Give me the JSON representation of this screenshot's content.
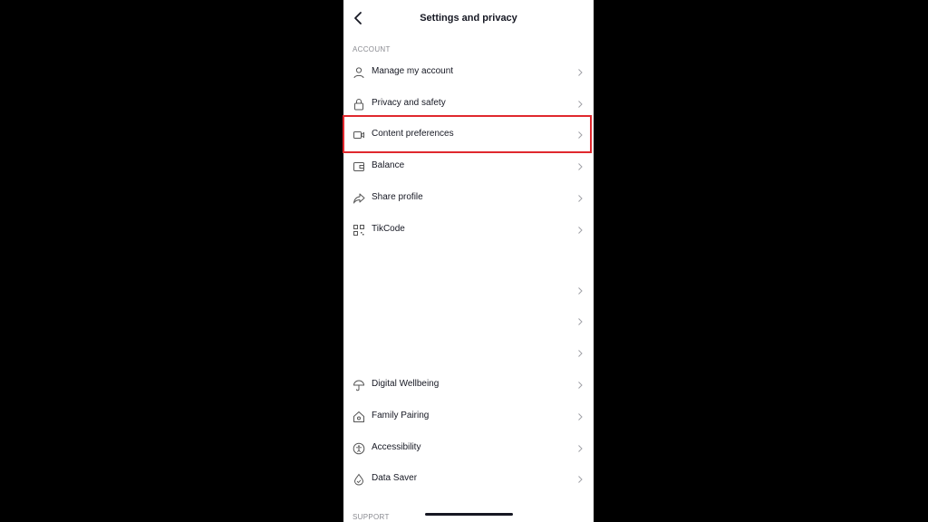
{
  "header": {
    "title": "Settings and privacy"
  },
  "sections": {
    "account_label": "ACCOUNT",
    "support_label": "SUPPORT"
  },
  "rows": [
    {
      "label": "Manage my account",
      "icon": "person-icon"
    },
    {
      "label": "Privacy and safety",
      "icon": "lock-icon"
    },
    {
      "label": "Content preferences",
      "icon": "video-camera-icon",
      "highlighted": true
    },
    {
      "label": "Balance",
      "icon": "wallet-icon"
    },
    {
      "label": "Share profile",
      "icon": "share-arrow-icon"
    },
    {
      "label": "TikCode",
      "icon": "qr-code-icon"
    },
    {
      "label": "",
      "icon": ""
    },
    {
      "label": "",
      "icon": ""
    },
    {
      "label": "",
      "icon": ""
    },
    {
      "label": "Digital Wellbeing",
      "icon": "umbrella-icon"
    },
    {
      "label": "Family Pairing",
      "icon": "house-icon"
    },
    {
      "label": "Accessibility",
      "icon": "accessibility-icon"
    },
    {
      "label": "Data Saver",
      "icon": "water-drop-icon"
    }
  ],
  "colors": {
    "highlight": "#e0282e",
    "text": "#161823",
    "muted": "#8a8b91"
  }
}
